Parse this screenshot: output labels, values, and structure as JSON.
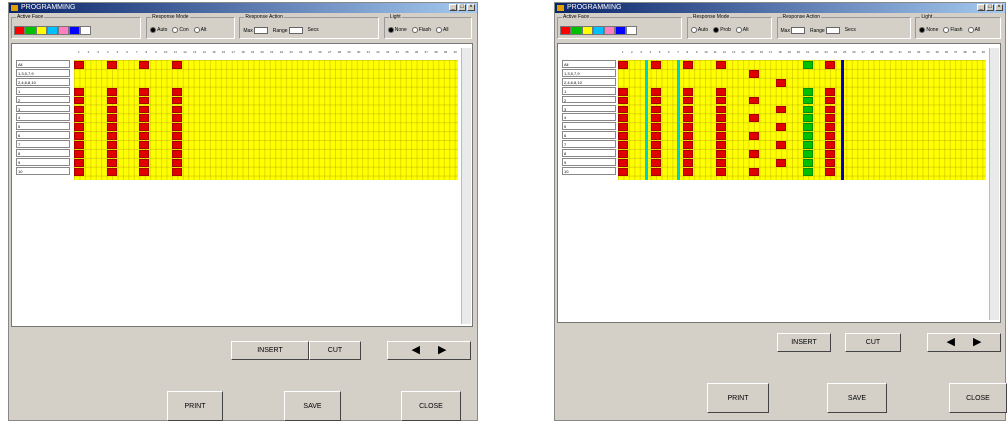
{
  "windows": [
    {
      "id": "left",
      "title": "PROGRAMMING",
      "active_face": {
        "legend": "Active Face",
        "chips": [
          {
            "label": "",
            "color": "#ff0000"
          },
          {
            "label": "",
            "color": "#00c000"
          },
          {
            "label": "",
            "color": "#ffff00"
          },
          {
            "label": "",
            "color": "#00c0ff"
          },
          {
            "label": "",
            "color": "#ff80c0"
          },
          {
            "label": "",
            "color": "#0000ff"
          },
          {
            "label": "",
            "color": "#ffffff"
          }
        ]
      },
      "response_mode": {
        "legend": "Response Mode",
        "options": [
          "Auto",
          "Con",
          "Alt"
        ],
        "selected": 0
      },
      "response_action": {
        "legend": "Response Action",
        "max_label": "Max",
        "range_label": "Range",
        "unit_label": "Secs"
      },
      "light": {
        "legend": "Light",
        "options": [
          "None",
          "Flash",
          "All"
        ],
        "selected": 0
      },
      "rows": [
        "All",
        "1,3,5,7,9",
        "2,4,6,8,10",
        "1",
        "2",
        "3",
        "4",
        "5",
        "6",
        "7",
        "8",
        "9",
        "10"
      ],
      "column_count": 40,
      "cells": [
        {
          "col": 0,
          "rows": [
            0,
            3,
            4,
            5,
            6,
            7,
            8,
            9,
            10,
            11,
            12
          ],
          "color": "#e00000"
        },
        {
          "col": 1,
          "rows": [
            0,
            3,
            4,
            5,
            6,
            7,
            8,
            9,
            10,
            11,
            12
          ],
          "color": "#e00000"
        },
        {
          "col": 2,
          "rows": [
            0,
            3,
            4,
            5,
            6,
            7,
            8,
            9,
            10,
            11,
            12
          ],
          "color": "#e00000"
        },
        {
          "col": 3,
          "rows": [
            0,
            3,
            4,
            5,
            6,
            7,
            8,
            9,
            10,
            11,
            12
          ],
          "color": "#e00000"
        }
      ],
      "separators": [],
      "buttons": {
        "insert": "INSERT",
        "cut": "CUT",
        "print": "PRINT",
        "save": "SAVE",
        "close": "CLOSE"
      }
    },
    {
      "id": "right",
      "title": "PROGRAMMING",
      "active_face": {
        "legend": "Active Face",
        "chips": [
          {
            "label": "",
            "color": "#ff0000"
          },
          {
            "label": "",
            "color": "#00c000"
          },
          {
            "label": "",
            "color": "#ffff00"
          },
          {
            "label": "",
            "color": "#00c0ff"
          },
          {
            "label": "",
            "color": "#ff80c0"
          },
          {
            "label": "",
            "color": "#0000ff"
          },
          {
            "label": "",
            "color": "#ffffff"
          }
        ]
      },
      "response_mode": {
        "legend": "Response Mode",
        "options": [
          "Auto",
          "Prob",
          "Alt"
        ],
        "selected": 1
      },
      "response_action": {
        "legend": "Response Action",
        "max_label": "Max",
        "range_label": "Range",
        "unit_label": "Secs"
      },
      "light": {
        "legend": "Light",
        "options": [
          "None",
          "Flash",
          "All"
        ],
        "selected": 0
      },
      "rows": [
        "All",
        "1,3,5,7,9",
        "2,4,6,8,10",
        "1",
        "2",
        "3",
        "4",
        "5",
        "6",
        "7",
        "8",
        "9",
        "10"
      ],
      "column_count": 40,
      "cells": [
        {
          "col": 0,
          "rows": [
            0,
            3,
            4,
            5,
            6,
            7,
            8,
            9,
            10,
            11,
            12
          ],
          "color": "#e00000"
        },
        {
          "col": 1,
          "rows": [
            0,
            3,
            4,
            5,
            6,
            7,
            8,
            9,
            10,
            11,
            12
          ],
          "color": "#e00000"
        },
        {
          "col": 2,
          "rows": [
            0,
            3,
            4,
            5,
            6,
            7,
            8,
            9,
            10,
            11,
            12
          ],
          "color": "#e00000"
        },
        {
          "col": 3,
          "rows": [
            0,
            3,
            4,
            5,
            6,
            7,
            8,
            9,
            10,
            11,
            12
          ],
          "color": "#e00000"
        },
        {
          "col": 4,
          "rows": [
            1,
            4,
            6,
            8,
            10,
            12
          ],
          "color": "#e00000"
        },
        {
          "col": 5,
          "rows": [
            2,
            5,
            7,
            9,
            11
          ],
          "color": "#e00000"
        },
        {
          "col": 6,
          "rows": [
            0,
            3,
            4,
            5,
            6,
            7,
            8,
            9,
            10,
            11,
            12
          ],
          "color": "#00c000"
        },
        {
          "col": 7,
          "rows": [
            0,
            3,
            4,
            5,
            6,
            7,
            8,
            9,
            10,
            11,
            12
          ],
          "color": "#e00000"
        }
      ],
      "separators": [
        {
          "after_col": 1,
          "color": "#00d0d0"
        },
        {
          "after_col": 3,
          "color": "#00d0d0"
        },
        {
          "after_col": 7,
          "color": "#0000c0"
        }
      ],
      "buttons": {
        "insert": "INSERT",
        "cut": "CUT",
        "print": "PRINT",
        "save": "SAVE",
        "close": "CLOSE"
      }
    }
  ]
}
